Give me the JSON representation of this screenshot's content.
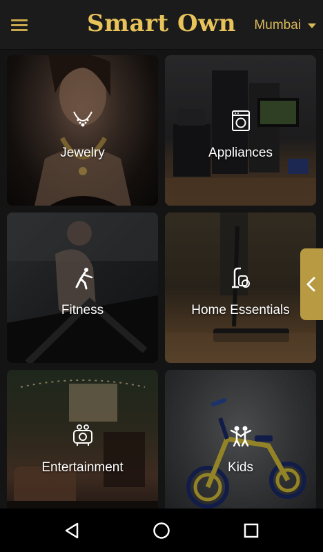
{
  "app": {
    "title": "Smart Own",
    "city": "Mumbai"
  },
  "categories": [
    {
      "label": "Jewelry",
      "icon": "necklace-icon"
    },
    {
      "label": "Appliances",
      "icon": "washing-machine-icon"
    },
    {
      "label": "Fitness",
      "icon": "exercise-icon"
    },
    {
      "label": "Home Essentials",
      "icon": "vacuum-cleaner-icon"
    },
    {
      "label": "Entertainment",
      "icon": "projector-icon"
    },
    {
      "label": "Kids",
      "icon": "children-icon"
    }
  ],
  "colors": {
    "accent": "#e7c35a",
    "appbar": "#1b1b1b",
    "handle": "#b79a42"
  }
}
